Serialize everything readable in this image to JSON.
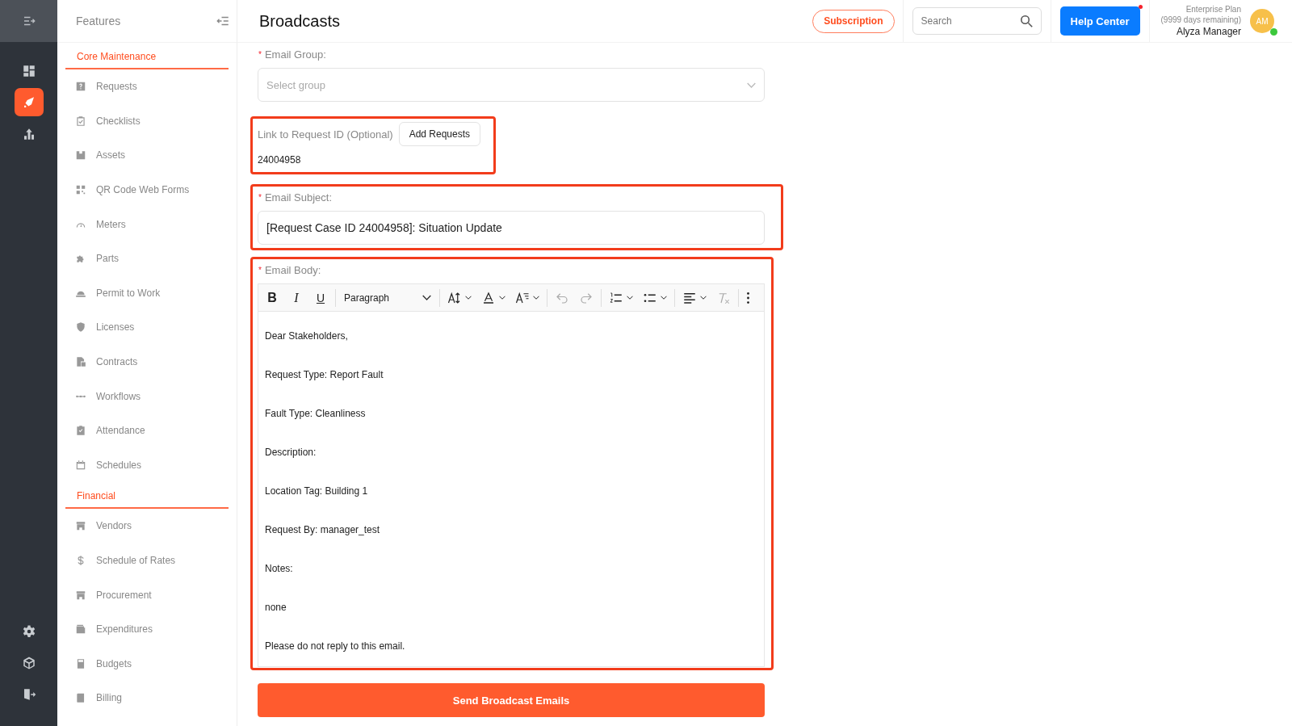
{
  "rail": {
    "items": [
      {
        "selected": false
      },
      {
        "selected": true
      },
      {
        "selected": false
      }
    ]
  },
  "sidebar": {
    "title": "Features",
    "sections": [
      {
        "title": "Core Maintenance",
        "items": [
          {
            "label": "Requests"
          },
          {
            "label": "Checklists"
          },
          {
            "label": "Assets"
          },
          {
            "label": "QR Code Web Forms"
          },
          {
            "label": "Meters"
          },
          {
            "label": "Parts"
          },
          {
            "label": "Permit to Work"
          },
          {
            "label": "Licenses"
          },
          {
            "label": "Contracts"
          },
          {
            "label": "Workflows"
          },
          {
            "label": "Attendance"
          },
          {
            "label": "Schedules"
          }
        ]
      },
      {
        "title": "Financial",
        "items": [
          {
            "label": "Vendors"
          },
          {
            "label": "Schedule of Rates"
          },
          {
            "label": "Procurement"
          },
          {
            "label": "Expenditures"
          },
          {
            "label": "Budgets"
          },
          {
            "label": "Billing"
          }
        ]
      }
    ]
  },
  "header": {
    "title": "Broadcasts",
    "subscription": "Subscription",
    "search": {
      "placeholder": "Search"
    },
    "help": "Help Center",
    "help_notification": true,
    "plan": "Enterprise Plan",
    "remaining": "(9999 days remaining)",
    "user": "Alyza Manager",
    "initials": "AM",
    "online": true
  },
  "form": {
    "group": {
      "marker": "*",
      "label": "Email Group:",
      "placeholder": "Select group"
    },
    "link": {
      "label": "Link to Request ID (Optional)",
      "button": "Add Requests",
      "value": "24004958",
      "highlighted": true
    },
    "subject": {
      "marker": "*",
      "label": "Email Subject:",
      "value": "[Request Case ID 24004958]: Situation Update",
      "highlighted": true
    },
    "body": {
      "marker": "*",
      "label": "Email Body:",
      "highlighted": true,
      "toolbar": [
        {
          "kind": "bold",
          "text": "B"
        },
        {
          "kind": "italic",
          "text": "I"
        },
        {
          "kind": "underline",
          "text": "U"
        },
        {
          "kind": "sep"
        },
        {
          "kind": "select",
          "text": "Paragraph"
        },
        {
          "kind": "sep"
        },
        {
          "kind": "fontsize"
        },
        {
          "kind": "fontcolor"
        },
        {
          "kind": "lineheight"
        },
        {
          "kind": "sep"
        },
        {
          "kind": "undo",
          "disabled": true
        },
        {
          "kind": "redo",
          "disabled": true
        },
        {
          "kind": "sep"
        },
        {
          "kind": "numlist"
        },
        {
          "kind": "bullist"
        },
        {
          "kind": "sep"
        },
        {
          "kind": "align"
        },
        {
          "kind": "clearformat",
          "disabled": true
        },
        {
          "kind": "sep"
        },
        {
          "kind": "more"
        }
      ],
      "paragraphs": [
        "Dear Stakeholders,",
        "Request Type: Report Fault",
        "Fault Type: Cleanliness",
        "Description:",
        "Location Tag: Building 1",
        "Request By: manager_test",
        "Notes:",
        "none",
        "Please do not reply to this email."
      ]
    },
    "submit": "Send Broadcast Emails"
  }
}
